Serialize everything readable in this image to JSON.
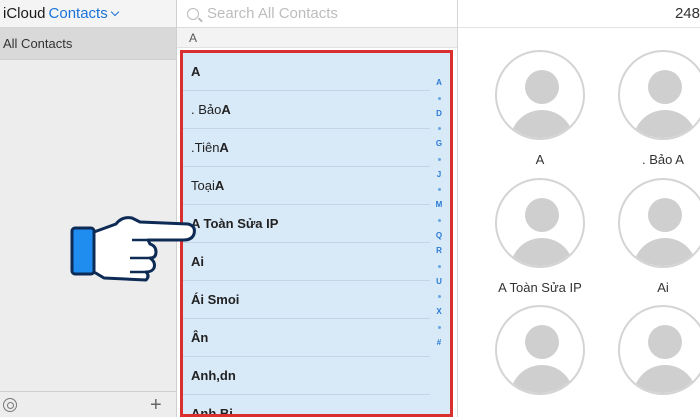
{
  "sidebar": {
    "brand": "iCloud",
    "app_menu_label": "Contacts",
    "group": "All Contacts"
  },
  "list": {
    "search_placeholder": "Search All Contacts",
    "section_header": "A",
    "contacts": [
      {
        "prefix": "",
        "bold": "A"
      },
      {
        "prefix": ". Bảo ",
        "bold": "A"
      },
      {
        "prefix": ".Tiên ",
        "bold": "A"
      },
      {
        "prefix": "Toại ",
        "bold": "A"
      },
      {
        "prefix": "",
        "bold": "A Toàn Sửa IP"
      },
      {
        "prefix": "",
        "bold": "Ai"
      },
      {
        "prefix": "",
        "bold": "Ái Smoi"
      },
      {
        "prefix": "",
        "bold": "Ân"
      },
      {
        "prefix": "",
        "bold": "Anh,dn"
      },
      {
        "prefix": "",
        "bold": "Anh Bi"
      }
    ],
    "index_letters": [
      "A",
      "D",
      "G",
      "J",
      "M",
      "Q",
      "R",
      "U",
      "X",
      "#"
    ]
  },
  "cards": {
    "count": "248",
    "tiles": [
      "A",
      ". Bảo A",
      "A Toàn Sửa IP",
      "Ai",
      "",
      ""
    ]
  },
  "colors": {
    "accent": "#1a73d9",
    "highlight_border": "#d9302f",
    "selection_bg": "#d8e9f8"
  }
}
